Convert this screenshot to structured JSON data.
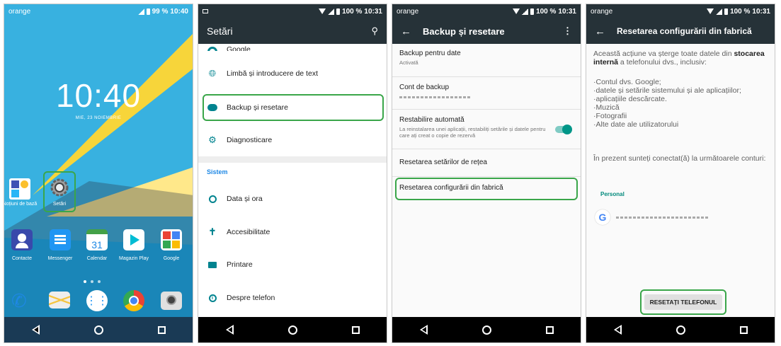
{
  "panel1": {
    "carrier": "orange",
    "battery": "99 %",
    "time": "10:40",
    "clock": "10:40",
    "date": "MIE, 23 NOIEMBRIE",
    "apps_row1": [
      {
        "label": "Noțiuni de bază"
      },
      {
        "label": "Setări"
      }
    ],
    "dock_row": [
      {
        "label": "Contacte"
      },
      {
        "label": "Messenger"
      },
      {
        "label": "Calendar",
        "badge": "31"
      },
      {
        "label": "Magazin Play"
      },
      {
        "label": "Google"
      }
    ]
  },
  "panel2": {
    "time": "10:31",
    "battery": "100 %",
    "title": "Setări",
    "items": [
      {
        "label": "Google"
      },
      {
        "label": "Limbă și introducere de text"
      },
      {
        "label": "Backup și resetare"
      },
      {
        "label": "Diagnosticare"
      }
    ],
    "section": "Sistem",
    "sys_items": [
      {
        "label": "Data și ora"
      },
      {
        "label": "Accesibilitate"
      },
      {
        "label": "Printare"
      },
      {
        "label": "Despre telefon"
      }
    ]
  },
  "panel3": {
    "carrier": "orange",
    "time": "10:31",
    "battery": "100 %",
    "title": "Backup și resetare",
    "backup_date": {
      "title": "Backup pentru date",
      "sub": "Activată"
    },
    "cont": {
      "title": "Cont de backup"
    },
    "restabilire": {
      "title": "Restabilire automată",
      "sub": "La reinstalarea unei aplicații, restabiliți setările și datele pentru care ați creat o copie de rezervă"
    },
    "retea": "Resetarea setărilor de rețea",
    "fabrica": "Resetarea configurării din fabrică"
  },
  "panel4": {
    "carrier": "orange",
    "time": "10:31",
    "battery": "100 %",
    "title": "Resetarea configurării din fabrică",
    "intro1": "Această acțiune va șterge toate datele din ",
    "intro_bold": "stocarea internă",
    "intro2": " a telefonului dvs., inclusiv:",
    "list": [
      "·Contul dvs. Google;",
      "·datele și setările sistemului și ale aplicațiilor;",
      "·aplicațiile descărcate.",
      "·Muzică",
      "·Fotografii",
      "·Alte date ale utilizatorului"
    ],
    "connected": "În prezent sunteți conectat(ă) la următoarele conturi:",
    "personal": "Personal",
    "button": "RESETAȚI TELEFONUL"
  }
}
